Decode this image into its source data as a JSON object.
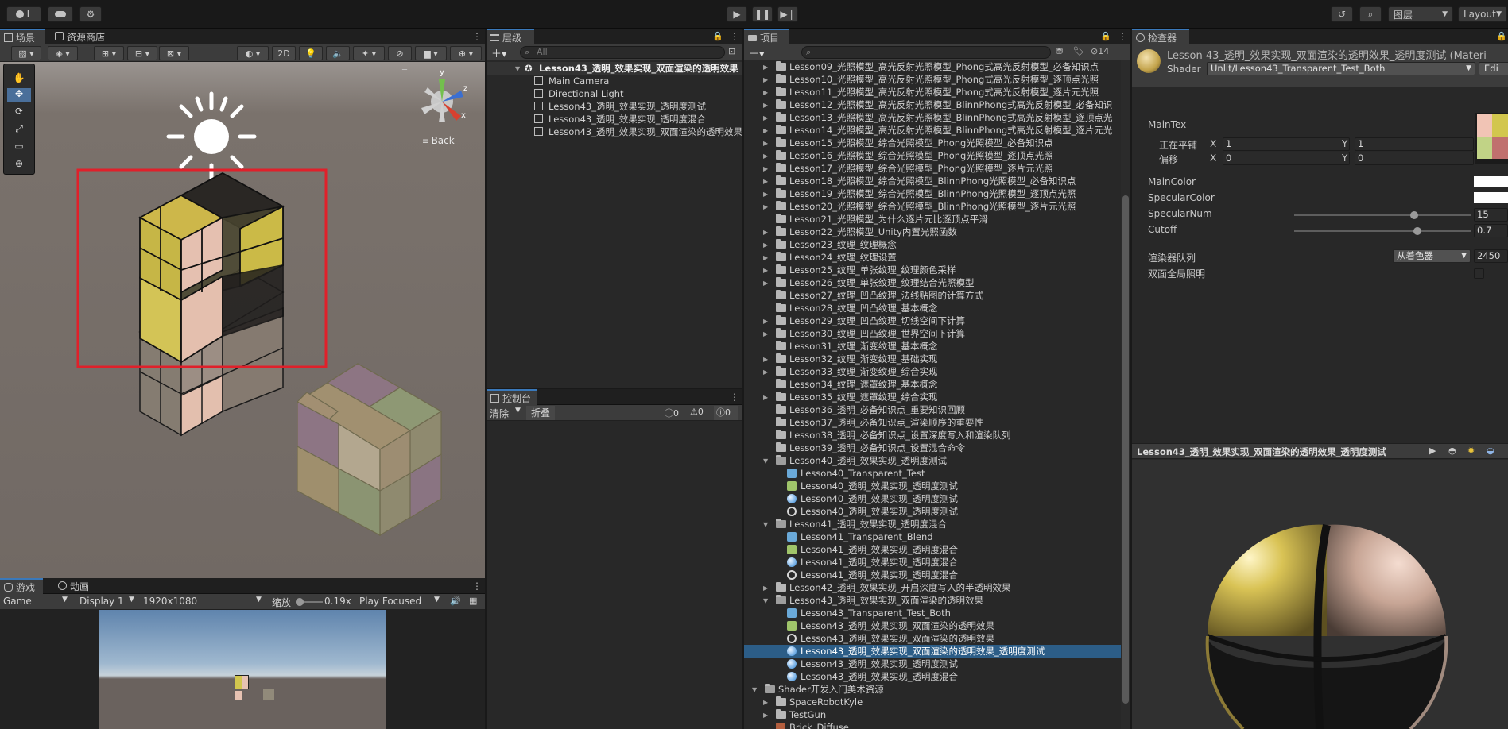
{
  "topbar": {
    "account_label": "L",
    "play_icon": "play-icon",
    "pause_icon": "pause-icon",
    "step_icon": "step-icon",
    "layers_label": "图层",
    "layout_label": "Layout"
  },
  "scene": {
    "tab_scene": "场景",
    "tab_store": "资源商店",
    "btn_2d": "2D",
    "gizmo_back": "Back",
    "axis_x": "x",
    "axis_y": "y",
    "axis_z": "z"
  },
  "game": {
    "tab_game": "游戏",
    "tab_animation": "动画",
    "mode": "Game",
    "display": "Display 1",
    "resolution": "1920x1080",
    "scale_label": "缩放",
    "scale_value": "0.19x",
    "play_focused": "Play Focused"
  },
  "hierarchy": {
    "tab": "层级",
    "search_placeholder": "All",
    "root": "Lesson43_透明_效果实现_双面渲染的透明效果",
    "items": [
      "Main Camera",
      "Directional Light",
      "Lesson43_透明_效果实现_透明度测试",
      "Lesson43_透明_效果实现_透明度混合",
      "Lesson43_透明_效果实现_双面渲染的透明效果"
    ]
  },
  "console": {
    "tab": "控制台",
    "clear": "清除",
    "collapse": "折叠",
    "count_info": "0",
    "count_warn": "0",
    "count_error": "0"
  },
  "project": {
    "tab": "项目",
    "hidden_count": "14",
    "rows": [
      {
        "label": "Lesson09_光照模型_高光反射光照模型_Phong式高光反射模型_必备知识点",
        "indent": 1,
        "type": "folder",
        "fold": "closed"
      },
      {
        "label": "Lesson10_光照模型_高光反射光照模型_Phong式高光反射模型_逐顶点光照",
        "indent": 1,
        "type": "folder",
        "fold": "closed"
      },
      {
        "label": "Lesson11_光照模型_高光反射光照模型_Phong式高光反射模型_逐片元光照",
        "indent": 1,
        "type": "folder",
        "fold": "closed"
      },
      {
        "label": "Lesson12_光照模型_高光反射光照模型_BlinnPhong式高光反射模型_必备知识",
        "indent": 1,
        "type": "folder",
        "fold": "closed"
      },
      {
        "label": "Lesson13_光照模型_高光反射光照模型_BlinnPhong式高光反射模型_逐顶点光",
        "indent": 1,
        "type": "folder",
        "fold": "closed"
      },
      {
        "label": "Lesson14_光照模型_高光反射光照模型_BlinnPhong式高光反射模型_逐片元光",
        "indent": 1,
        "type": "folder",
        "fold": "closed"
      },
      {
        "label": "Lesson15_光照模型_综合光照模型_Phong光照模型_必备知识点",
        "indent": 1,
        "type": "folder",
        "fold": "closed"
      },
      {
        "label": "Lesson16_光照模型_综合光照模型_Phong光照模型_逐顶点光照",
        "indent": 1,
        "type": "folder",
        "fold": "closed"
      },
      {
        "label": "Lesson17_光照模型_综合光照模型_Phong光照模型_逐片元光照",
        "indent": 1,
        "type": "folder",
        "fold": "closed"
      },
      {
        "label": "Lesson18_光照模型_综合光照模型_BlinnPhong光照模型_必备知识点",
        "indent": 1,
        "type": "folder",
        "fold": "closed"
      },
      {
        "label": "Lesson19_光照模型_综合光照模型_BlinnPhong光照模型_逐顶点光照",
        "indent": 1,
        "type": "folder",
        "fold": "closed"
      },
      {
        "label": "Lesson20_光照模型_综合光照模型_BlinnPhong光照模型_逐片元光照",
        "indent": 1,
        "type": "folder",
        "fold": "closed"
      },
      {
        "label": "Lesson21_光照模型_为什么逐片元比逐顶点平滑",
        "indent": 1,
        "type": "folder",
        "fold": "none"
      },
      {
        "label": "Lesson22_光照模型_Unity内置光照函数",
        "indent": 1,
        "type": "folder",
        "fold": "closed"
      },
      {
        "label": "Lesson23_纹理_纹理概念",
        "indent": 1,
        "type": "folder",
        "fold": "closed"
      },
      {
        "label": "Lesson24_纹理_纹理设置",
        "indent": 1,
        "type": "folder",
        "fold": "closed"
      },
      {
        "label": "Lesson25_纹理_单张纹理_纹理颜色采样",
        "indent": 1,
        "type": "folder",
        "fold": "closed"
      },
      {
        "label": "Lesson26_纹理_单张纹理_纹理结合光照模型",
        "indent": 1,
        "type": "folder",
        "fold": "closed"
      },
      {
        "label": "Lesson27_纹理_凹凸纹理_法线贴图的计算方式",
        "indent": 1,
        "type": "folder",
        "fold": "none"
      },
      {
        "label": "Lesson28_纹理_凹凸纹理_基本概念",
        "indent": 1,
        "type": "folder",
        "fold": "none"
      },
      {
        "label": "Lesson29_纹理_凹凸纹理_切线空间下计算",
        "indent": 1,
        "type": "folder",
        "fold": "closed"
      },
      {
        "label": "Lesson30_纹理_凹凸纹理_世界空间下计算",
        "indent": 1,
        "type": "folder",
        "fold": "closed"
      },
      {
        "label": "Lesson31_纹理_渐变纹理_基本概念",
        "indent": 1,
        "type": "folder",
        "fold": "none"
      },
      {
        "label": "Lesson32_纹理_渐变纹理_基础实现",
        "indent": 1,
        "type": "folder",
        "fold": "closed"
      },
      {
        "label": "Lesson33_纹理_渐变纹理_综合实现",
        "indent": 1,
        "type": "folder",
        "fold": "closed"
      },
      {
        "label": "Lesson34_纹理_遮罩纹理_基本概念",
        "indent": 1,
        "type": "folder",
        "fold": "none"
      },
      {
        "label": "Lesson35_纹理_遮罩纹理_综合实现",
        "indent": 1,
        "type": "folder",
        "fold": "closed"
      },
      {
        "label": "Lesson36_透明_必备知识点_重要知识回顾",
        "indent": 1,
        "type": "folder",
        "fold": "none"
      },
      {
        "label": "Lesson37_透明_必备知识点_渲染顺序的重要性",
        "indent": 1,
        "type": "folder",
        "fold": "none"
      },
      {
        "label": "Lesson38_透明_必备知识点_设置深度写入和渲染队列",
        "indent": 1,
        "type": "folder",
        "fold": "none"
      },
      {
        "label": "Lesson39_透明_必备知识点_设置混合命令",
        "indent": 1,
        "type": "folder",
        "fold": "none"
      },
      {
        "label": "Lesson40_透明_效果实现_透明度测试",
        "indent": 1,
        "type": "folder",
        "fold": "open"
      },
      {
        "label": "Lesson40_Transparent_Test",
        "indent": 2,
        "type": "shader",
        "fold": "none"
      },
      {
        "label": "Lesson40_透明_效果实现_透明度测试",
        "indent": 2,
        "type": "script",
        "fold": "none"
      },
      {
        "label": "Lesson40_透明_效果实现_透明度测试",
        "indent": 2,
        "type": "material",
        "fold": "none"
      },
      {
        "label": "Lesson40_透明_效果实现_透明度测试",
        "indent": 2,
        "type": "scene",
        "fold": "none"
      },
      {
        "label": "Lesson41_透明_效果实现_透明度混合",
        "indent": 1,
        "type": "folder",
        "fold": "open"
      },
      {
        "label": "Lesson41_Transparent_Blend",
        "indent": 2,
        "type": "shader",
        "fold": "none"
      },
      {
        "label": "Lesson41_透明_效果实现_透明度混合",
        "indent": 2,
        "type": "script",
        "fold": "none"
      },
      {
        "label": "Lesson41_透明_效果实现_透明度混合",
        "indent": 2,
        "type": "material",
        "fold": "none"
      },
      {
        "label": "Lesson41_透明_效果实现_透明度混合",
        "indent": 2,
        "type": "scene",
        "fold": "none"
      },
      {
        "label": "Lesson42_透明_效果实现_开启深度写入的半透明效果",
        "indent": 1,
        "type": "folder",
        "fold": "closed"
      },
      {
        "label": "Lesson43_透明_效果实现_双面渲染的透明效果",
        "indent": 1,
        "type": "folder",
        "fold": "open"
      },
      {
        "label": "Lesson43_Transparent_Test_Both",
        "indent": 2,
        "type": "shader",
        "fold": "none"
      },
      {
        "label": "Lesson43_透明_效果实现_双面渲染的透明效果",
        "indent": 2,
        "type": "script",
        "fold": "none"
      },
      {
        "label": "Lesson43_透明_效果实现_双面渲染的透明效果",
        "indent": 2,
        "type": "scene",
        "fold": "none"
      },
      {
        "label": "Lesson43_透明_效果实现_双面渲染的透明效果_透明度测试",
        "indent": 2,
        "type": "material",
        "fold": "none",
        "selected": true
      },
      {
        "label": "Lesson43_透明_效果实现_透明度测试",
        "indent": 2,
        "type": "material",
        "fold": "none"
      },
      {
        "label": "Lesson43_透明_效果实现_透明度混合",
        "indent": 2,
        "type": "material",
        "fold": "none"
      },
      {
        "label": "Shader开发入门美术资源",
        "indent": 0,
        "type": "folder",
        "fold": "open"
      },
      {
        "label": "SpaceRobotKyle",
        "indent": 1,
        "type": "folder",
        "fold": "closed"
      },
      {
        "label": "TestGun",
        "indent": 1,
        "type": "folder",
        "fold": "closed"
      },
      {
        "label": "Brick_Diffuse",
        "indent": 1,
        "type": "texture",
        "fold": "none"
      }
    ]
  },
  "inspector": {
    "tab": "检查器",
    "title": "Lesson 43_透明_效果实现_双面渲染的透明效果_透明度测试 (Materi",
    "shader_label": "Shader",
    "shader_value": "Unlit/Lesson43_Transparent_Test_Both",
    "edit_label": "Edi",
    "main_tex": "MainTex",
    "tiling_label": "正在平铺",
    "offset_label": "偏移",
    "x_label": "X",
    "y_label": "Y",
    "tiling_x": "1",
    "tiling_y": "1",
    "offset_x": "0",
    "offset_y": "0",
    "main_color": "MainColor",
    "specular_color": "SpecularColor",
    "specular_num_label": "SpecularNum",
    "specular_num_value": "15",
    "specular_num_fraction": 0.68,
    "cutoff_label": "Cutoff",
    "cutoff_value": "0.7",
    "cutoff_fraction": 0.7,
    "render_queue_label": "渲染器队列",
    "render_queue_mode": "从着色器",
    "render_queue_value": "2450",
    "double_sided_gi": "双面全局照明",
    "preview_title": "Lesson43_透明_效果实现_双面渲染的透明效果_透明度测试"
  },
  "colors": {
    "selection": "#2c5d87",
    "panel": "#282828",
    "scene_bg": "#6e6660",
    "cube_yellow": "#d2c64e",
    "cube_pink": "#e7c2b2",
    "accent_red": "#e0202a"
  }
}
